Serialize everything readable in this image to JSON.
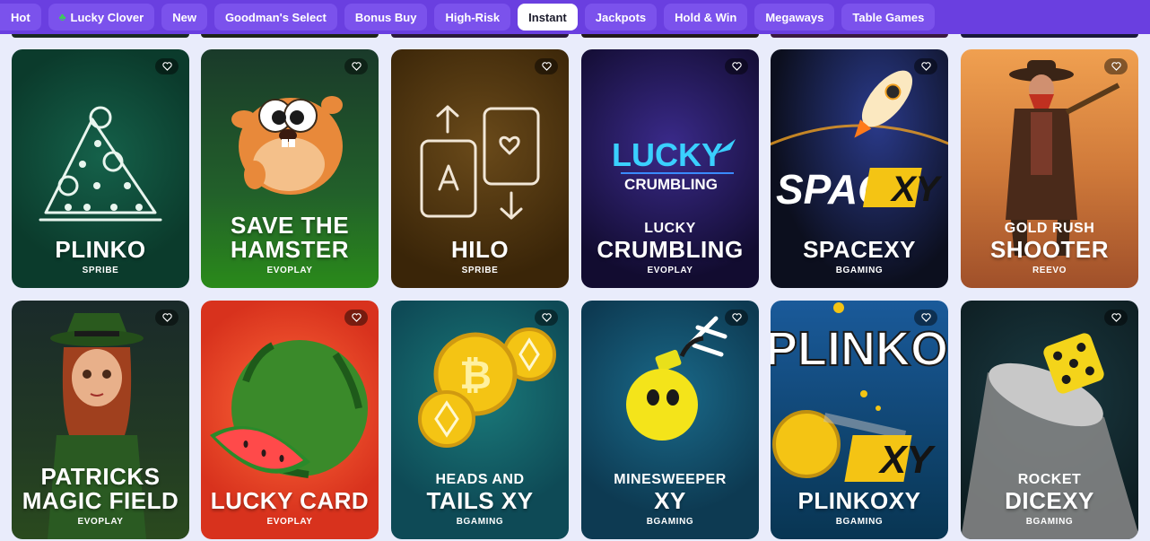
{
  "categories": [
    {
      "label": "Hot",
      "active": false
    },
    {
      "label": "Lucky Clover",
      "active": false,
      "icon": "clover-icon"
    },
    {
      "label": "New",
      "active": false
    },
    {
      "label": "Goodman's Select",
      "active": false
    },
    {
      "label": "Bonus Buy",
      "active": false
    },
    {
      "label": "High-Risk",
      "active": false
    },
    {
      "label": "Instant",
      "active": true
    },
    {
      "label": "Jackpots",
      "active": false
    },
    {
      "label": "Hold & Win",
      "active": false
    },
    {
      "label": "Megaways",
      "active": false
    },
    {
      "label": "Table Games",
      "active": false
    }
  ],
  "games": [
    {
      "title_small": "",
      "title": "PLINKO",
      "provider": "SPRIBE",
      "bg": "#0b3b2c"
    },
    {
      "title_small": "",
      "title": "SAVE THE HAMSTER",
      "title_line1": "SAVE THE",
      "title_line2": "HAMSTER",
      "provider": "EVOPLAY",
      "bg": "#2a7a1a"
    },
    {
      "title_small": "",
      "title": "HILO",
      "provider": "SPRIBE",
      "bg": "#4a3310"
    },
    {
      "title_small": "LUCKY",
      "title": "CRUMBLING",
      "provider": "EVOPLAY",
      "bg": "#1b1446",
      "logo_top": "LUCKY",
      "logo_bottom": "CRUMBLING"
    },
    {
      "title_small": "",
      "title": "SPACEXY",
      "provider": "BGAMING",
      "bg": "#0c0f1e",
      "logo_left": "SPACE",
      "logo_right": "XY"
    },
    {
      "title_small": "GOLD RUSH",
      "title": "SHOOTER",
      "provider": "REEVO",
      "bg": "#b8642c"
    },
    {
      "title_small": "",
      "title": "PATRICKS MAGIC FIELD",
      "title_line1": "PATRICKS",
      "title_line2": "MAGIC FIELD",
      "provider": "EVOPLAY",
      "bg": "#1c2c1a"
    },
    {
      "title_small": "",
      "title": "LUCKY CARD",
      "provider": "EVOPLAY",
      "bg": "#d8321d"
    },
    {
      "title_small": "HEADS AND",
      "title": "TAILS XY",
      "provider": "BGAMING",
      "bg": "#0e4a56"
    },
    {
      "title_small": "MINESWEEPER",
      "title": "XY",
      "provider": "BGAMING",
      "bg": "#0d3a52"
    },
    {
      "title_small": "",
      "title": "PLINKOXY",
      "provider": "BGAMING",
      "bg": "#083552",
      "logo_top": "PLINKO",
      "logo_xy": "XY"
    },
    {
      "title_small": "ROCKET",
      "title": "DICEXY",
      "provider": "BGAMING",
      "bg": "#0e1e22"
    }
  ]
}
